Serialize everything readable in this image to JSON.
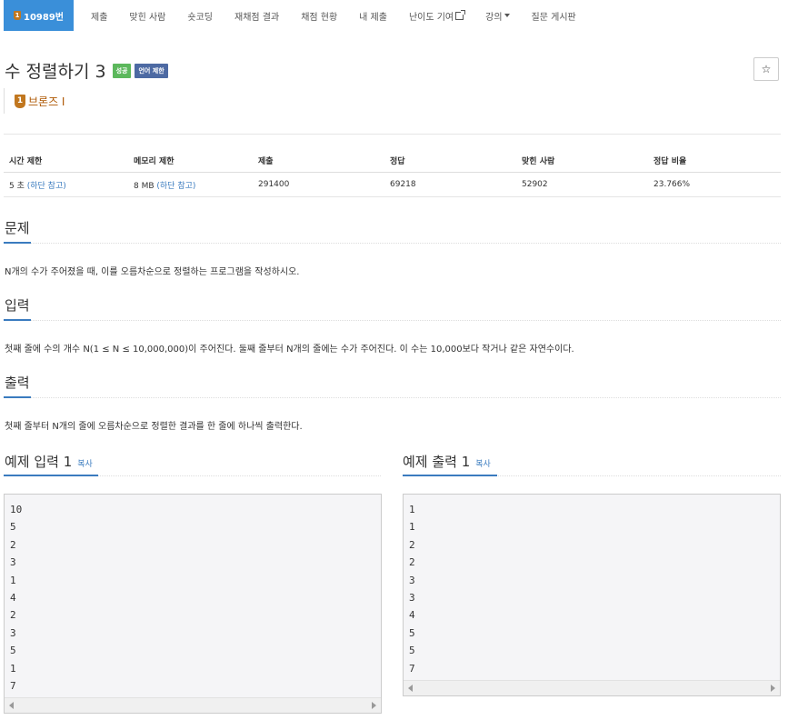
{
  "nav": {
    "problem_badge": "1",
    "problem_number": "10989번",
    "items": [
      "제출",
      "맞힌 사람",
      "숏코딩",
      "재채점 결과",
      "채점 현황",
      "내 제출",
      "난이도 기여",
      "강의"
    ],
    "board": "질문 게시판"
  },
  "problem": {
    "title": "수 정렬하기 3",
    "label_success": "성공",
    "label_lang": "언어 제한",
    "star": "☆",
    "tier_badge": "1",
    "tier": "브론즈 I"
  },
  "info_table": {
    "headers": [
      "시간 제한",
      "메모리 제한",
      "제출",
      "정답",
      "맞힌 사람",
      "정답 비율"
    ],
    "time": "5 초 ",
    "time_note": "(하단 참고)",
    "memory": "8 MB ",
    "memory_note": "(하단 참고)",
    "submissions": "291400",
    "accepted": "69218",
    "solvers": "52902",
    "ratio": "23.766%"
  },
  "sections": {
    "problem_h": "문제",
    "problem_text": "N개의 수가 주어졌을 때, 이를 오름차순으로 정렬하는 프로그램을 작성하시오.",
    "input_h": "입력",
    "input_text": "첫째 줄에 수의 개수 N(1 ≤ N ≤ 10,000,000)이 주어진다. 둘째 줄부터 N개의 줄에는 수가 주어진다. 이 수는 10,000보다 작거나 같은 자연수이다.",
    "output_h": "출력",
    "output_text": "첫째 줄부터 N개의 줄에 오름차순으로 정렬한 결과를 한 줄에 하나씩 출력한다."
  },
  "samples": {
    "input_h": "예제 입력 1",
    "output_h": "예제 출력 1",
    "copy": "복사",
    "input_lines": [
      "10",
      "5",
      "2",
      "3",
      "1",
      "4",
      "2",
      "3",
      "5",
      "1",
      "7"
    ],
    "output_lines": [
      "1",
      "1",
      "2",
      "2",
      "3",
      "3",
      "4",
      "5",
      "5",
      "7"
    ]
  }
}
